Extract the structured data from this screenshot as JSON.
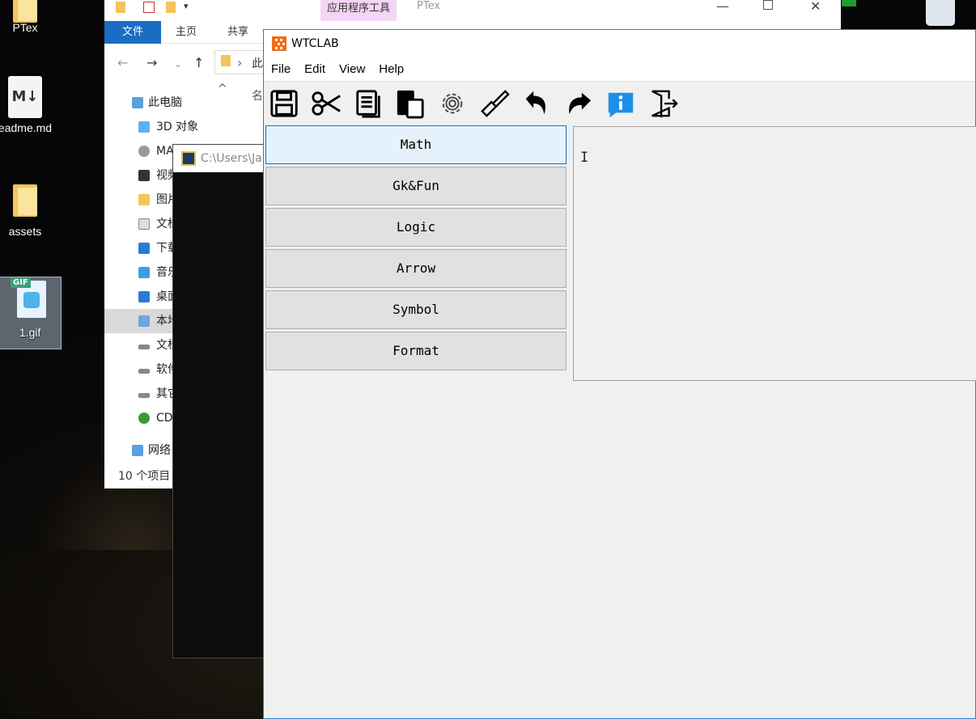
{
  "desktop": {
    "icons": [
      {
        "label": "PTex"
      },
      {
        "label": "eadme.md"
      },
      {
        "label": "assets"
      },
      {
        "label": "1.gif"
      }
    ]
  },
  "explorer": {
    "context_tab": "应用程序工具",
    "context_name": "PTex",
    "ribbon_tabs": [
      "文件",
      "主页",
      "共享"
    ],
    "address": "此",
    "tree_header": "名",
    "tree": [
      {
        "label": "此电脑"
      },
      {
        "label": "3D 对象"
      },
      {
        "label": "MA"
      },
      {
        "label": "视频"
      },
      {
        "label": "图片"
      },
      {
        "label": "文档"
      },
      {
        "label": "下载"
      },
      {
        "label": "音乐"
      },
      {
        "label": "桌面"
      },
      {
        "label": "本地"
      },
      {
        "label": "文档"
      },
      {
        "label": "软件"
      },
      {
        "label": "其它"
      },
      {
        "label": "CD"
      },
      {
        "label": "网络"
      }
    ],
    "status": "10 个项目"
  },
  "console": {
    "title": "C:\\Users\\Ja"
  },
  "app": {
    "title": "WTCLAB",
    "menu": [
      "File",
      "Edit",
      "View",
      "Help"
    ],
    "toolbar": [
      {
        "icon": "save-icon"
      },
      {
        "icon": "cut-icon"
      },
      {
        "icon": "copy-icon"
      },
      {
        "icon": "paste-icon"
      },
      {
        "icon": "settings-icon"
      },
      {
        "icon": "brush-icon"
      },
      {
        "icon": "undo-icon"
      },
      {
        "icon": "redo-icon"
      },
      {
        "icon": "info-icon"
      },
      {
        "icon": "exit-icon"
      }
    ],
    "categories": [
      "Math",
      "Gk&Fun",
      "Logic",
      "Arrow",
      "Symbol",
      "Format"
    ],
    "editor": {
      "value": ""
    }
  }
}
